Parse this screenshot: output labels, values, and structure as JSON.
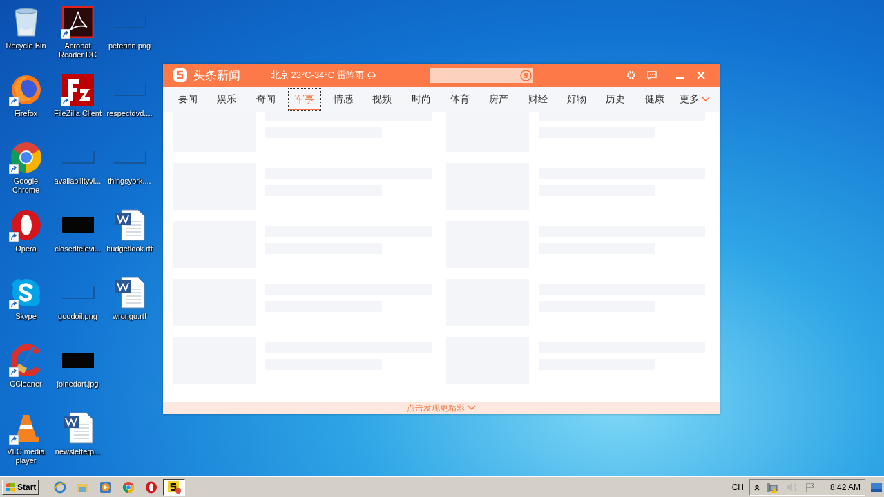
{
  "desktop": {
    "icons": [
      {
        "label": "Recycle Bin",
        "kind": "recycle",
        "shortcut": false
      },
      {
        "label": "Firefox",
        "kind": "firefox",
        "shortcut": true
      },
      {
        "label": "Google Chrome",
        "kind": "chrome",
        "shortcut": true
      },
      {
        "label": "Opera",
        "kind": "opera",
        "shortcut": true
      },
      {
        "label": "Skype",
        "kind": "skype",
        "shortcut": true
      },
      {
        "label": "CCleaner",
        "kind": "ccleaner",
        "shortcut": true
      },
      {
        "label": "VLC media player",
        "kind": "vlc",
        "shortcut": true
      },
      {
        "label": "Acrobat Reader DC",
        "kind": "acrobat",
        "shortcut": true
      },
      {
        "label": "FileZilla Client",
        "kind": "filezilla",
        "shortcut": true
      },
      {
        "label": "availabilityvi...",
        "kind": "thumb",
        "shortcut": false
      },
      {
        "label": "closedtelevi...",
        "kind": "dark",
        "shortcut": false
      },
      {
        "label": "goodoil.png",
        "kind": "thumb",
        "shortcut": false
      },
      {
        "label": "joinedart.jpg",
        "kind": "dark",
        "shortcut": false
      },
      {
        "label": "newsletterp...",
        "kind": "word",
        "shortcut": false
      },
      {
        "label": "peterinn.png",
        "kind": "thumb",
        "shortcut": false
      },
      {
        "label": "respectdvd....",
        "kind": "thumb",
        "shortcut": false
      },
      {
        "label": "thingsyork....",
        "kind": "thumb",
        "shortcut": false
      },
      {
        "label": "budgetlook.rtf",
        "kind": "word",
        "shortcut": false
      },
      {
        "label": "wrongu.rtf",
        "kind": "word",
        "shortcut": false
      }
    ]
  },
  "window": {
    "app_name": "头条新闻",
    "weather": "北京 23°C-34°C 雷阵雨",
    "tabs": [
      {
        "label": "要闻",
        "selected": false
      },
      {
        "label": "娱乐",
        "selected": false
      },
      {
        "label": "奇闻",
        "selected": false
      },
      {
        "label": "军事",
        "selected": true
      },
      {
        "label": "情感",
        "selected": false
      },
      {
        "label": "视频",
        "selected": false
      },
      {
        "label": "时尚",
        "selected": false
      },
      {
        "label": "体育",
        "selected": false
      },
      {
        "label": "房产",
        "selected": false
      },
      {
        "label": "财经",
        "selected": false
      },
      {
        "label": "好物",
        "selected": false
      },
      {
        "label": "历史",
        "selected": false
      },
      {
        "label": "健康",
        "selected": false
      }
    ],
    "more": "更多",
    "footer": "点击发现更精彩"
  },
  "taskbar": {
    "start": "Start",
    "apps": [
      {
        "kind": "ie",
        "selected": false
      },
      {
        "kind": "folder",
        "selected": false
      },
      {
        "kind": "media",
        "selected": false
      },
      {
        "kind": "chrome",
        "selected": false
      },
      {
        "kind": "opera",
        "selected": false
      },
      {
        "kind": "news",
        "selected": true
      }
    ],
    "language": "CH",
    "clock": "8:42 AM"
  }
}
